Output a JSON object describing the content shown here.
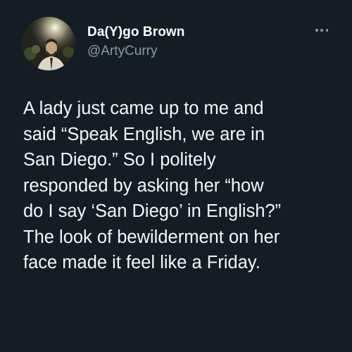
{
  "tweet": {
    "author": {
      "display_name": "Da(Y)go Brown",
      "handle": "@ArtyCurry",
      "avatar_icon": "profile-photo"
    },
    "more_icon": "more-horizontal-icon",
    "text_lines": [
      "A lady just came up to me and",
      "said “Speak English, we are in",
      "San Diego.” So I politely",
      "responded by asking her “how",
      "do I say ‘San Diego’ in English?”",
      "The look of bewilderment on her",
      "face made it feel like a Friday."
    ]
  },
  "colors": {
    "background": "#141d26",
    "text": "#f5f8fa",
    "secondary": "#8b98a5"
  }
}
